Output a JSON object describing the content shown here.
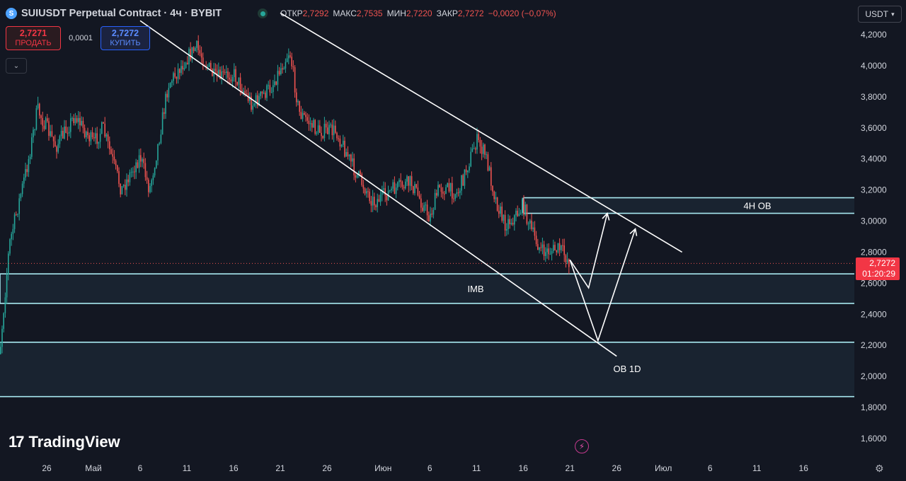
{
  "header": {
    "title": "SUIUSDT Perpetual Contract · 4ч · BYBIT",
    "ohlc": [
      {
        "k": "ОТКР",
        "v": "2,7292"
      },
      {
        "k": "МАКС",
        "v": "2,7535"
      },
      {
        "k": "МИН",
        "v": "2,7220"
      },
      {
        "k": "ЗАКР",
        "v": "2,7272"
      },
      {
        "k": "",
        "v": "−0,0020 (−0,07%)"
      }
    ]
  },
  "trade": {
    "sell_price": "2,7271",
    "sell_label": "ПРОДАТЬ",
    "spread": "0,0001",
    "buy_price": "2,7272",
    "buy_label": "КУПИТЬ"
  },
  "currency": "USDT",
  "last_price": {
    "value": "2,7272",
    "countdown": "01:20:29"
  },
  "branding": "TradingView",
  "colors": {
    "background": "#131722",
    "up": "#26a69a",
    "down": "#ef5350",
    "drawing": "#ffffff",
    "zone": "#a8e8f0",
    "zone_fill": "#1c2836"
  },
  "chart_data": {
    "type": "candlestick",
    "symbol": "SUIUSDT",
    "timeframe": "4ч",
    "ylim": [
      1.52,
      4.34
    ],
    "y_ticks": [
      "4,2000",
      "4,0000",
      "3,8000",
      "3,6000",
      "3,4000",
      "3,2000",
      "3,0000",
      "2,8000",
      "2,6000",
      "2,4000",
      "2,2000",
      "2,0000",
      "1,8000",
      "1,6000"
    ],
    "y_tick_values": [
      4.2,
      4.0,
      3.8,
      3.6,
      3.4,
      3.2,
      3.0,
      2.8,
      2.6,
      2.4,
      2.2,
      2.0,
      1.8,
      1.6
    ],
    "x_ticks": [
      "26",
      "Май",
      "6",
      "11",
      "16",
      "21",
      "26",
      "Июн",
      "6",
      "11",
      "16",
      "21",
      "26",
      "Июл",
      "6",
      "11",
      "16"
    ],
    "x_tick_dates": [
      "2024-04-26",
      "2024-05-01",
      "2024-05-06",
      "2024-05-11",
      "2024-05-16",
      "2024-05-21",
      "2024-05-26",
      "2024-06-01",
      "2024-06-06",
      "2024-06-11",
      "2024-06-16",
      "2024-06-21",
      "2024-06-26",
      "2024-07-01",
      "2024-07-06",
      "2024-07-11",
      "2024-07-16"
    ],
    "price_path": [
      [
        "2024-04-20",
        2.22
      ],
      [
        "2024-04-21",
        2.17
      ],
      [
        "2024-04-22",
        2.85
      ],
      [
        "2024-04-24",
        3.38
      ],
      [
        "2024-04-25",
        3.72
      ],
      [
        "2024-04-27",
        3.48
      ],
      [
        "2024-04-29",
        3.68
      ],
      [
        "2024-05-01",
        3.5
      ],
      [
        "2024-05-02",
        3.6
      ],
      [
        "2024-05-04",
        3.2
      ],
      [
        "2024-05-06",
        3.42
      ],
      [
        "2024-05-07",
        3.2
      ],
      [
        "2024-05-08",
        3.52
      ],
      [
        "2024-05-09",
        3.88
      ],
      [
        "2024-05-11",
        4.05
      ],
      [
        "2024-05-12",
        4.12
      ],
      [
        "2024-05-14",
        3.92
      ],
      [
        "2024-05-16",
        3.95
      ],
      [
        "2024-05-18",
        3.75
      ],
      [
        "2024-05-20",
        3.86
      ],
      [
        "2024-05-21",
        3.98
      ],
      [
        "2024-05-22",
        4.1
      ],
      [
        "2024-05-23",
        3.7
      ],
      [
        "2024-05-25",
        3.58
      ],
      [
        "2024-05-27",
        3.58
      ],
      [
        "2024-05-29",
        3.32
      ],
      [
        "2024-05-31",
        3.12
      ],
      [
        "2024-06-02",
        3.2
      ],
      [
        "2024-06-04",
        3.25
      ],
      [
        "2024-06-06",
        3.02
      ],
      [
        "2024-06-07",
        3.22
      ],
      [
        "2024-06-09",
        3.18
      ],
      [
        "2024-06-11",
        3.52
      ],
      [
        "2024-06-12",
        3.42
      ],
      [
        "2024-06-13",
        3.15
      ],
      [
        "2024-06-14",
        2.98
      ],
      [
        "2024-06-15",
        3.02
      ],
      [
        "2024-06-16",
        3.1
      ],
      [
        "2024-06-17",
        2.92
      ],
      [
        "2024-06-18",
        2.8
      ],
      [
        "2024-06-20",
        2.82
      ],
      [
        "2024-06-21",
        2.73
      ]
    ],
    "drawings": {
      "channel_upper": [
        [
          "2024-05-21",
          4.34
        ],
        [
          "2024-07-03",
          2.8
        ]
      ],
      "channel_lower": [
        [
          "2024-05-06",
          4.29
        ],
        [
          "2024-06-26",
          2.13
        ]
      ],
      "zones": [
        {
          "label": "4H OB",
          "from_date": "2024-06-16",
          "top": 3.15,
          "bottom": 3.05
        },
        {
          "label": "IMB",
          "from_date": "2024-04-21",
          "top": 2.66,
          "bottom": 2.47
        },
        {
          "label": "OB 1D",
          "from_date": "2024-04-20",
          "top": 2.22,
          "bottom": 1.87
        }
      ],
      "projection_paths": [
        [
          [
            "2024-06-21",
            2.75
          ],
          [
            "2024-06-23",
            2.57
          ],
          [
            "2024-06-25",
            3.05
          ]
        ],
        [
          [
            "2024-06-21",
            2.75
          ],
          [
            "2024-06-24",
            2.23
          ],
          [
            "2024-06-28",
            2.95
          ]
        ]
      ]
    }
  }
}
